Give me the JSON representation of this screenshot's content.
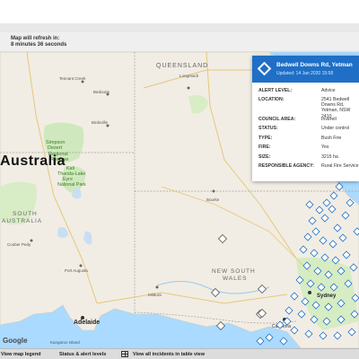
{
  "refresh": {
    "line1": "Map will refresh in:",
    "line2": "8 minutes 36 seconds"
  },
  "map": {
    "country_label": "Australia",
    "state_labels": {
      "qld": "QUEENSLAND",
      "sa": "SOUTH\nAUSTRALIA",
      "nsw": "NEW SOUTH\nWALES"
    },
    "places": [
      {
        "name": "Tennant Creek"
      },
      {
        "name": "Mount Isa"
      },
      {
        "name": "Longreach"
      },
      {
        "name": "Bedourie"
      },
      {
        "name": "Birdsville"
      },
      {
        "name": "Simpson Desert Regional Reserve"
      },
      {
        "name": "Kati Thanda-Lake Eyre National Park"
      },
      {
        "name": "Coober Pedy"
      },
      {
        "name": "Port Augusta"
      },
      {
        "name": "Adelaide"
      },
      {
        "name": "Kangaroo Island"
      },
      {
        "name": "Mildura"
      },
      {
        "name": "Canberra"
      },
      {
        "name": "Sydney"
      },
      {
        "name": "Bourke"
      }
    ],
    "fire_color": "#1f6fc6",
    "other_incident_color": "#555555"
  },
  "incident": {
    "title": "Bedwell Downs Rd, Yetman",
    "updated": "Updated: 14 Jan 2020 15:58",
    "fields": [
      {
        "k": "ALERT LEVEL:",
        "v": "Advice"
      },
      {
        "k": "LOCATION:",
        "v": "2541 Bedwell Downs Rd, Yetman, NSW 2410"
      },
      {
        "k": "COUNCIL AREA:",
        "v": "Inverell"
      },
      {
        "k": "STATUS:",
        "v": "Under control"
      },
      {
        "k": "TYPE:",
        "v": "Bush Fire"
      },
      {
        "k": "FIRE:",
        "v": "Yes"
      },
      {
        "k": "SIZE:",
        "v": "3215 ha"
      },
      {
        "k": "RESPONSIBLE AGENCY:",
        "v": "Rural Fire Service"
      }
    ]
  },
  "bottom": {
    "legend": "View map legend",
    "status": "Status & alert levels",
    "table": "View all incidents in table view"
  },
  "attribution": "Google"
}
